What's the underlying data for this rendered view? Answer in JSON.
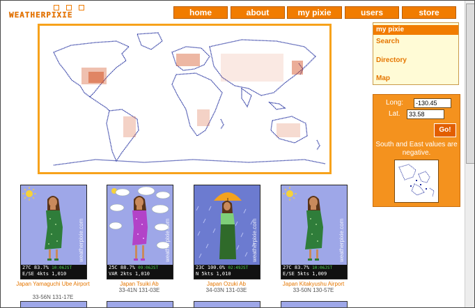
{
  "logo": {
    "text": "WEATHERPIXIE"
  },
  "nav": [
    {
      "label": "home"
    },
    {
      "label": "about"
    },
    {
      "label": "my pixie"
    },
    {
      "label": "users"
    },
    {
      "label": "store"
    }
  ],
  "side_menu": [
    {
      "label": "my pixie",
      "active": true
    },
    {
      "label": "Search"
    },
    {
      "label": "Directory"
    },
    {
      "label": "Map"
    }
  ],
  "geo": {
    "long_label": "Long:",
    "long_value": "-130.45",
    "lat_label": "Lat.",
    "lat_value": "33.58",
    "go_label": "Go!",
    "note": "South and East values are negative."
  },
  "pixies": [
    {
      "line1": "27C 83.7%",
      "time": "10:06JST",
      "line2": "E/SE 4kts  1,010",
      "name": "Japan Yamaguchi Ube Airport",
      "coords": "33-56N 131-17E",
      "watermark": "weatherpixie.com"
    },
    {
      "line1": "25C 88.7%",
      "time": "09:06JST",
      "line2": "VAR 2kts  1,010",
      "name": "Japan Tsuiki Ab",
      "coords": "33-41N 131-03E",
      "watermark": "weatherpixie.com"
    },
    {
      "line1": "23C 100.0%",
      "time": "02:49JST",
      "line2": "N 5kts  1,010",
      "name": "Japan Ozuki Ab",
      "coords": "34-03N 131-03E",
      "watermark": "weatherpixie.com"
    },
    {
      "line1": "27C 83.7%",
      "time": "10:06JST",
      "line2": "E/SE 5kts  1,009",
      "name": "Japan Kitakyushu Airport",
      "coords": "33-50N 130-57E",
      "watermark": "weatherpixie.com"
    }
  ],
  "colors": {
    "accent": "#f17c00",
    "link": "#e57600",
    "map_border": "#f7a21b",
    "panel_bg": "#fffbd6"
  }
}
